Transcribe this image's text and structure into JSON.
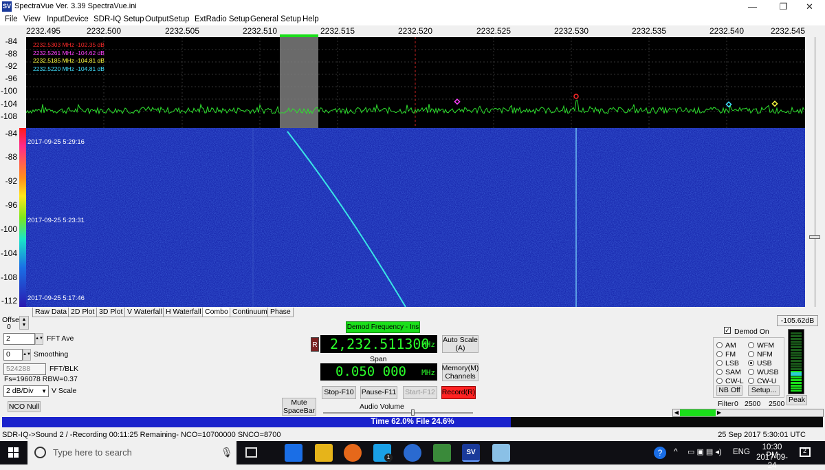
{
  "window": {
    "title": "SpectraVue Ver. 3.39  SpectraVue.ini",
    "app_icon": "SV",
    "minimize": "—",
    "maximize": "❐",
    "close": "✕"
  },
  "menu": [
    "File",
    "View",
    "InputDevice",
    "SDR-IQ Setup",
    "OutputSetup",
    "ExtRadio Setup",
    "General Setup",
    "Help"
  ],
  "freq_axis": [
    "2232.495",
    "2232.500",
    "2232.505",
    "2232.510",
    "2232.515",
    "2232.520",
    "2232.525",
    "2232.530",
    "2232.535",
    "2232.540",
    "2232.545"
  ],
  "spectrum_y_labels": [
    "-84",
    "-88",
    "-92",
    "-96",
    "-100",
    "-104",
    "-108"
  ],
  "waterfall_y_labels": [
    "-84",
    "-88",
    "-92",
    "-96",
    "-100",
    "-104",
    "-108",
    "-112"
  ],
  "markers": [
    {
      "text": "2232.5303 MHz  -102.35 dB",
      "color": "#ff2a2a"
    },
    {
      "text": "2232.5261 MHz  -104.62 dB",
      "color": "#ff40ff"
    },
    {
      "text": "2232.5185 MHz  -104.81 dB",
      "color": "#ffff40"
    },
    {
      "text": "2232.5220 MHz  -104.81 dB",
      "color": "#40e0ff"
    }
  ],
  "waterfall_timestamps": [
    "2017-09-25 5:29:16",
    "2017-09-25 5:23:31",
    "2017-09-25 5:17:46"
  ],
  "tabs": [
    "Raw Data",
    "2D Plot",
    "3D Plot",
    "V Waterfall",
    "H Waterfall",
    "Combo",
    "Continuum",
    "Phase"
  ],
  "selected_tab": "Combo",
  "left_panel": {
    "offset_label": "Offset",
    "offset_value": "0",
    "fft_ave_value": "2",
    "fft_ave_label": "FFT Ave",
    "smoothing_value": "0",
    "smoothing_label": "Smoothing",
    "fft_blk_value": "524288",
    "fft_blk_label": "FFT/BLK",
    "fs_text": "Fs=196078 RBW=0.37",
    "vscale_value": "2 dB/Div",
    "vscale_label": "V Scale",
    "nco_null": "NCO Null"
  },
  "demod": {
    "demod_freq_label": "Demod Frequency - Ins",
    "r_button": "R",
    "frequency": "2,232.511300",
    "freq_unit": "MHz",
    "span_label": "Span",
    "span_value": "0.050 000",
    "span_unit": "MHz",
    "auto_scale": "Auto Scale (A)",
    "memory": "Memory(M) Channels",
    "mute": "Mute SpaceBar",
    "stop": "Stop-F10",
    "pause": "Pause-F11",
    "start": "Start-F12",
    "record": "Record(R)",
    "audio_volume": "Audio Volume"
  },
  "right_panel": {
    "level": "-105.62dB",
    "demod_on": "Demod On",
    "modes_left": [
      "AM",
      "FM",
      "LSB",
      "SAM",
      "CW-L"
    ],
    "modes_right": [
      "WFM",
      "NFM",
      "USB",
      "WUSB",
      "CW-U"
    ],
    "selected_mode": "USB",
    "nb_off": "NB Off",
    "setup": "Setup...",
    "filter_label": "Filter",
    "filter_values": [
      "0",
      "2500",
      "2500"
    ],
    "peak": "Peak"
  },
  "progress": {
    "text": "Time 62.0%   File 24.6%",
    "fill": 0.62
  },
  "status": {
    "left": "SDR-IQ->Sound 2  / -Recording 00:11:25 Remaining-    NCO=10700000   SNCO=8700",
    "right": "25 Sep 2017  5:30:01 UTC"
  },
  "taskbar": {
    "search_placeholder": "Type here to search",
    "lang": "ENG",
    "time": "10:30 PM",
    "date": "2017-09-24",
    "notification_count": "2",
    "skype_badge": "1"
  },
  "colors": {
    "accent_green": "#1adf1a",
    "lcd_green": "#2bff2b",
    "progress_blue": "#1a22cc",
    "record_red": "#ff2222",
    "waterfall_blue": "#1a2bb0"
  }
}
